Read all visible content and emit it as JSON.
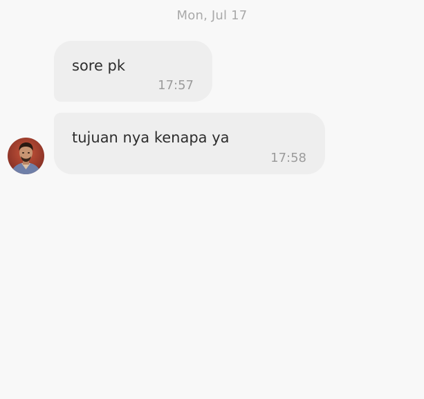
{
  "conversation": {
    "date_divider": "Mon, Jul 17",
    "messages": [
      {
        "text": "sore pk",
        "time": "17:57"
      },
      {
        "text": "tujuan nya kenapa ya",
        "time": "17:58"
      }
    ]
  },
  "colors": {
    "background": "#f8f8f8",
    "bubble": "#eeeeee",
    "message_text": "#2d2d2d",
    "timestamp": "#9b9b9b",
    "date_divider": "#a9a9a9"
  },
  "avatar": {
    "icon": "person-photo-avatar"
  }
}
